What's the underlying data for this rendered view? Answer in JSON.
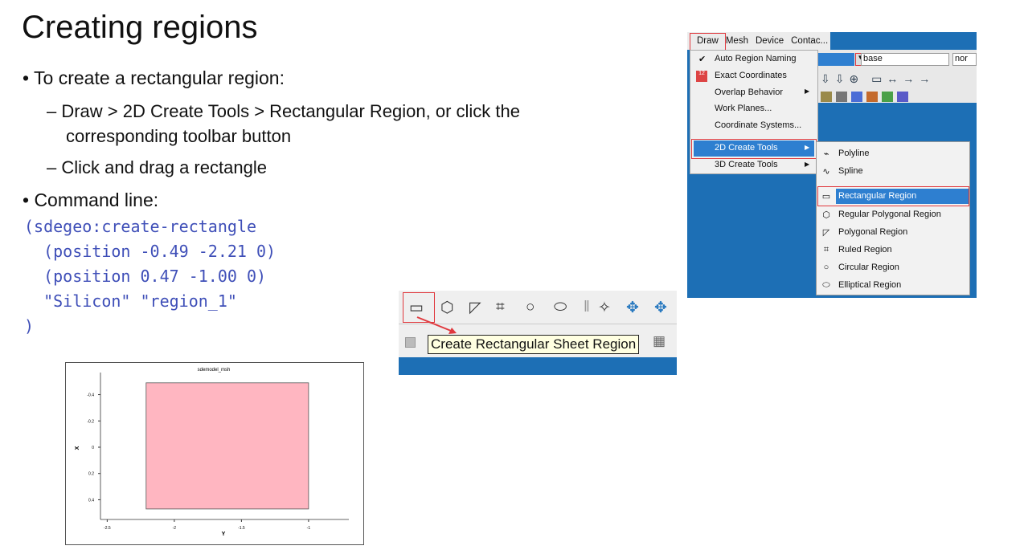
{
  "slide": {
    "title": "Creating regions",
    "bullets": [
      {
        "text": "• To create a rectangular region:"
      },
      {
        "text": "– Draw > 2D Create Tools > Rectangular Region, or click the"
      },
      {
        "text": "corresponding toolbar button"
      },
      {
        "text": "– Click and drag a rectangle"
      },
      {
        "text": "• Command line:"
      }
    ],
    "code": [
      "(sdegeo:create-rectangle",
      "  (position -0.49 -2.21 0)",
      "  (position 0.47 -1.00 0)",
      "  \"Silicon\" \"region_1\"",
      ")"
    ]
  },
  "menu_screenshot": {
    "menubar": [
      "Draw",
      "Mesh",
      "Device",
      "Contac..."
    ],
    "combo_value": "base",
    "combo_value2": "nor",
    "draw_menu": [
      {
        "label": "Auto Region Naming",
        "checked": true
      },
      {
        "label": "Exact Coordinates"
      },
      {
        "label": "Overlap Behavior",
        "submenu": true
      },
      {
        "label": "Work Planes..."
      },
      {
        "label": "Coordinate Systems..."
      },
      {
        "label": "2D Create Tools",
        "submenu": true,
        "highlighted": true
      },
      {
        "label": "3D Create Tools",
        "submenu": true
      }
    ],
    "create_2d_submenu": [
      {
        "label": "Polyline",
        "icon": "polyline-icon"
      },
      {
        "label": "Spline",
        "icon": "spline-icon"
      },
      {
        "label": "Rectangular Region",
        "icon": "rectangle-icon",
        "highlighted": true
      },
      {
        "label": "Regular Polygonal Region",
        "icon": "hexagon-icon"
      },
      {
        "label": "Polygonal Region",
        "icon": "polygon-icon"
      },
      {
        "label": "Ruled Region",
        "icon": "ruled-icon"
      },
      {
        "label": "Circular Region",
        "icon": "circle-icon"
      },
      {
        "label": "Elliptical Region",
        "icon": "ellipse-icon"
      }
    ]
  },
  "toolbar_screenshot": {
    "tooltip": "Create Rectangular Sheet Region"
  },
  "plot": {
    "title": "sdemodel_msh",
    "xlabel": "Y",
    "ylabel": "X",
    "x_ticks": [
      "-2.5",
      "-2",
      "-1.5",
      "-1"
    ],
    "y_ticks": [
      "-0.4",
      "-0.2",
      "0",
      "0.2",
      "0.4"
    ],
    "region": {
      "y_min": -2.21,
      "y_max": -1.0,
      "x_min": -0.49,
      "x_max": 0.47,
      "color": "#ffb6c1"
    }
  },
  "colors": {
    "accent_red": "#e0393e",
    "code_blue": "#3f4fb8",
    "menu_highlight": "#2e7fd0"
  }
}
